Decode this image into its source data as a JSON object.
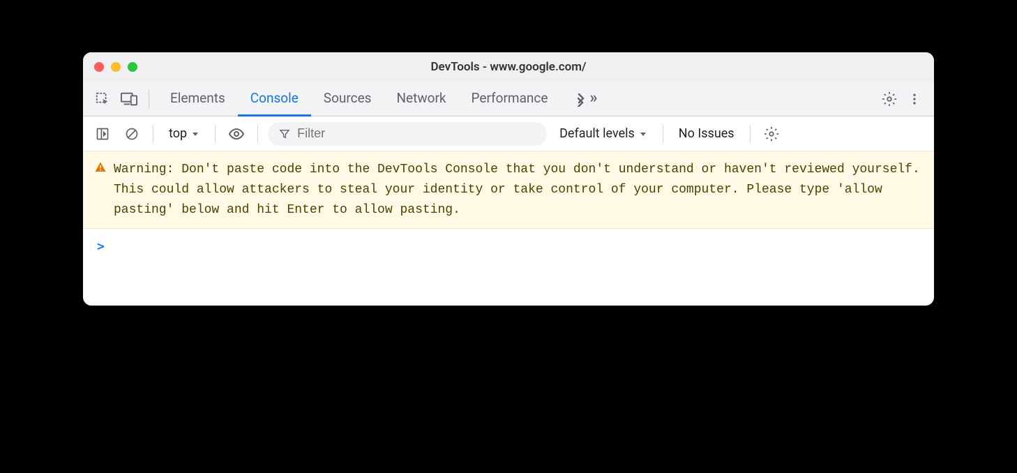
{
  "window": {
    "title": "DevTools - www.google.com/"
  },
  "tabs": {
    "elements": "Elements",
    "console": "Console",
    "sources": "Sources",
    "network": "Network",
    "performance": "Performance"
  },
  "toolbar": {
    "context": "top",
    "filter_placeholder": "Filter",
    "levels": "Default levels",
    "issues": "No Issues"
  },
  "warning": {
    "text": "Warning: Don't paste code into the DevTools Console that you don't understand or haven't reviewed yourself. This could allow attackers to steal your identity or take control of your computer. Please type 'allow pasting' below and hit Enter to allow pasting."
  },
  "prompt": {
    "symbol": ">"
  }
}
